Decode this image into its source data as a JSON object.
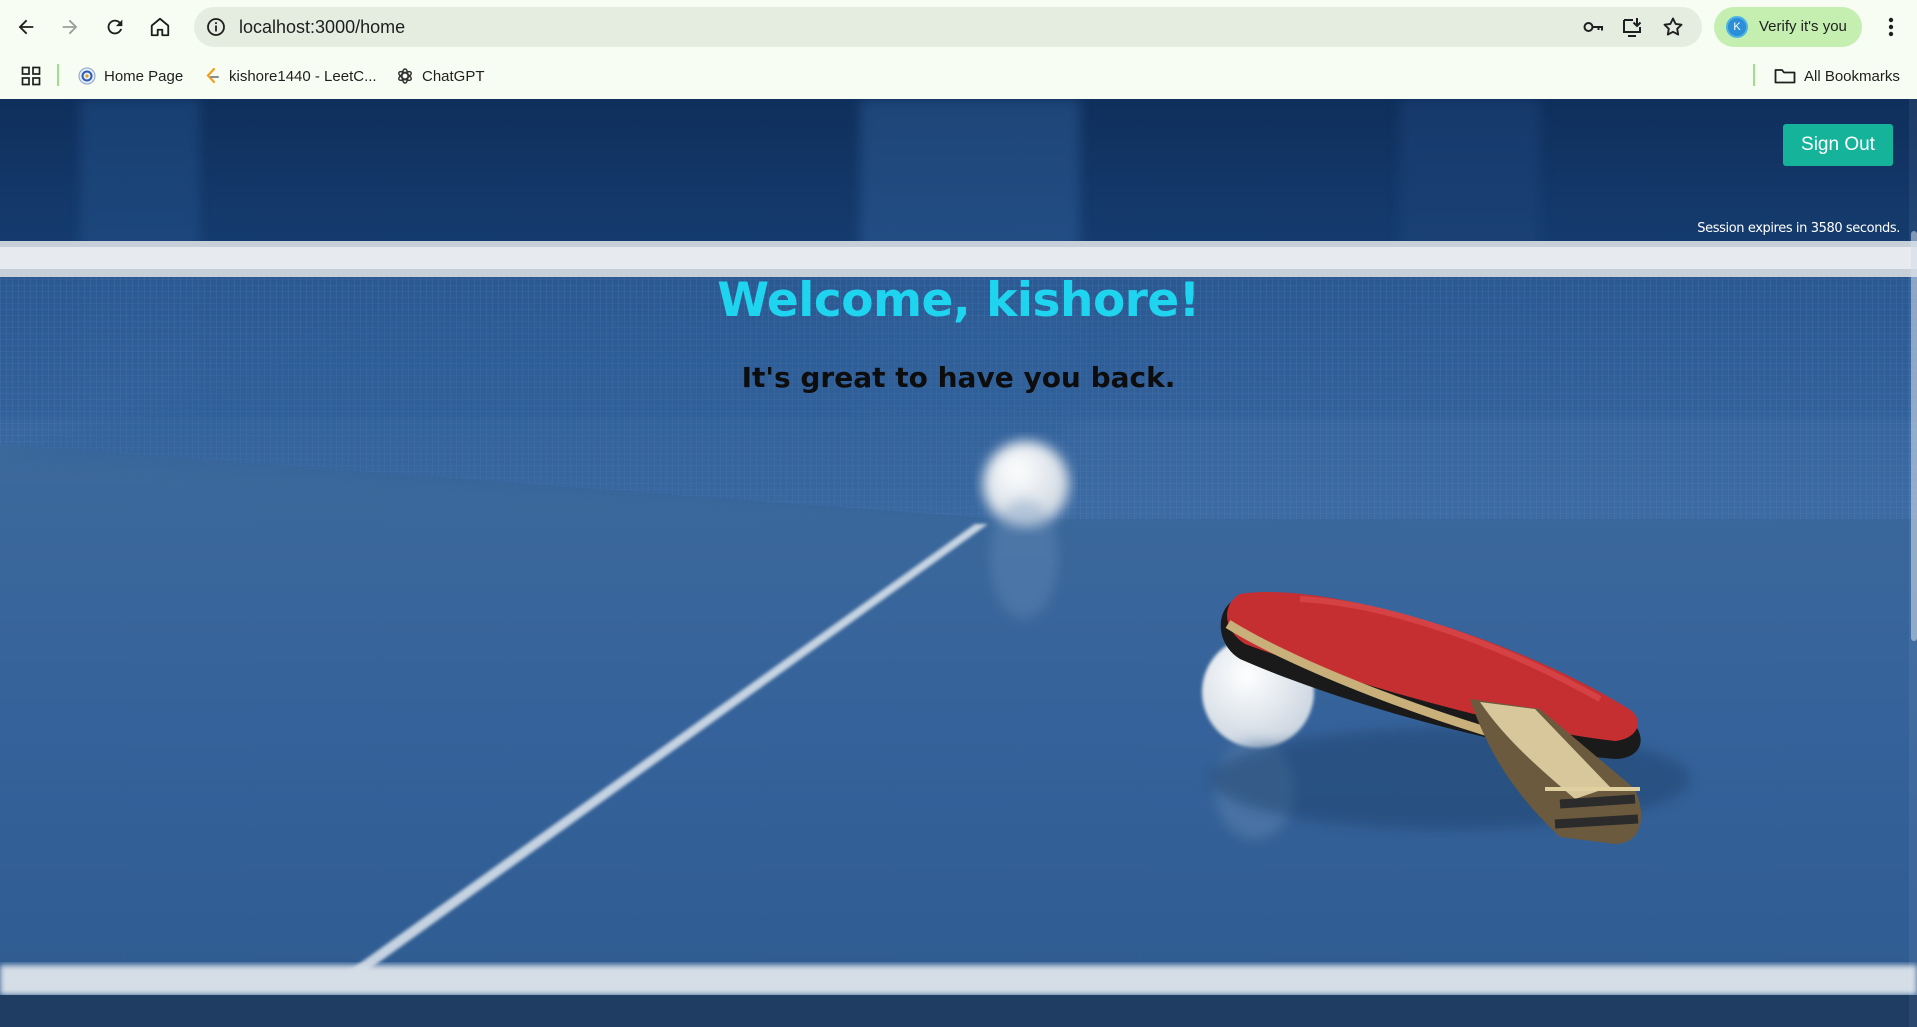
{
  "browser": {
    "url": "localhost:3000/home",
    "profile_initial": "K",
    "profile_button_label": "Verify it's you"
  },
  "bookmarks": {
    "items": [
      {
        "label": "Home Page"
      },
      {
        "label": "kishore1440 - LeetC..."
      },
      {
        "label": "ChatGPT"
      }
    ],
    "all_bookmarks_label": "All Bookmarks"
  },
  "page": {
    "sign_out_label": "Sign Out",
    "session_text": "Session expires in 3580 seconds.",
    "welcome_heading": "Welcome, kishore!",
    "subtitle": "It's great to have you back."
  },
  "colors": {
    "sign_out_bg": "#16b39b",
    "welcome_color": "#1fd4ee",
    "browser_chrome": "#f8fdf3",
    "verify_chip": "#c4efb1"
  },
  "icons": [
    "back-icon",
    "forward-icon",
    "reload-icon",
    "home-icon",
    "site-info-icon",
    "password-key-icon",
    "install-app-icon",
    "bookmark-star-icon",
    "chrome-menu-icon",
    "apps-grid-icon",
    "folder-icon"
  ]
}
